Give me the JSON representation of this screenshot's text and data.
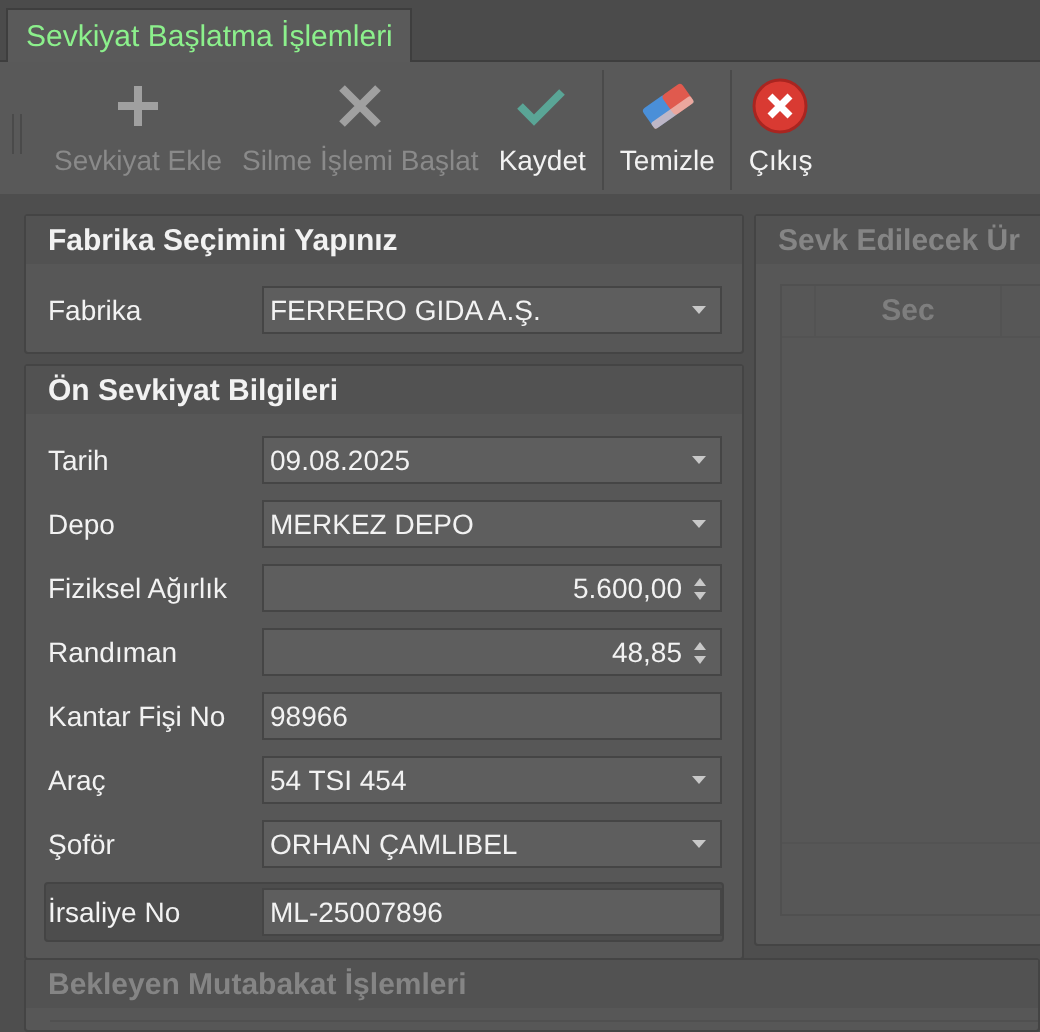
{
  "tab": {
    "label": "Sevkiyat Başlatma İşlemleri",
    "selected": true
  },
  "toolbar": [
    {
      "label": "Sevkiyat Ekle",
      "disabled": true
    },
    {
      "label": "Silme İşlemi Başlat",
      "disabled": true
    },
    {
      "label": "Kaydet",
      "disabled": false
    },
    {
      "label": "Temizle",
      "disabled": false
    },
    {
      "label": "Çıkış",
      "disabled": false
    }
  ],
  "factory_panel": {
    "title": "Fabrika Seçimini Yapınız",
    "fields": [
      {
        "label": "Fabrika",
        "value": "FERRERO GIDA A.Ş.",
        "kind": "dropdown",
        "focused": false
      }
    ]
  },
  "shipment_panel": {
    "title": "Ön Sevkiyat Bilgileri",
    "fields": [
      {
        "label": "Tarih",
        "value": "09.08.2025",
        "kind": "dropdown",
        "focused": false
      },
      {
        "label": "Depo",
        "value": "MERKEZ DEPO",
        "kind": "dropdown",
        "focused": false
      },
      {
        "label": "Fiziksel Ağırlık",
        "value": "5.600,00",
        "kind": "spin",
        "focused": false
      },
      {
        "label": "Randıman",
        "value": "48,85",
        "kind": "spin",
        "focused": false
      },
      {
        "label": "Kantar Fişi No",
        "value": "98966",
        "kind": "text",
        "focused": false
      },
      {
        "label": "Araç",
        "value": "54 TSI 454",
        "kind": "dropdown",
        "focused": false
      },
      {
        "label": "Şoför",
        "value": "ORHAN ÇAMLIBEL",
        "kind": "dropdown",
        "focused": false
      },
      {
        "label": "İrsaliye No",
        "value": "ML-25007896",
        "kind": "text",
        "focused": true
      }
    ]
  },
  "products_panel": {
    "title": "Sevk Edilecek Ür",
    "disabled": true,
    "columns": [
      "Sec"
    ]
  },
  "pending_panel": {
    "title": "Bekleyen Mutabakat İşlemleri",
    "disabled": true
  }
}
